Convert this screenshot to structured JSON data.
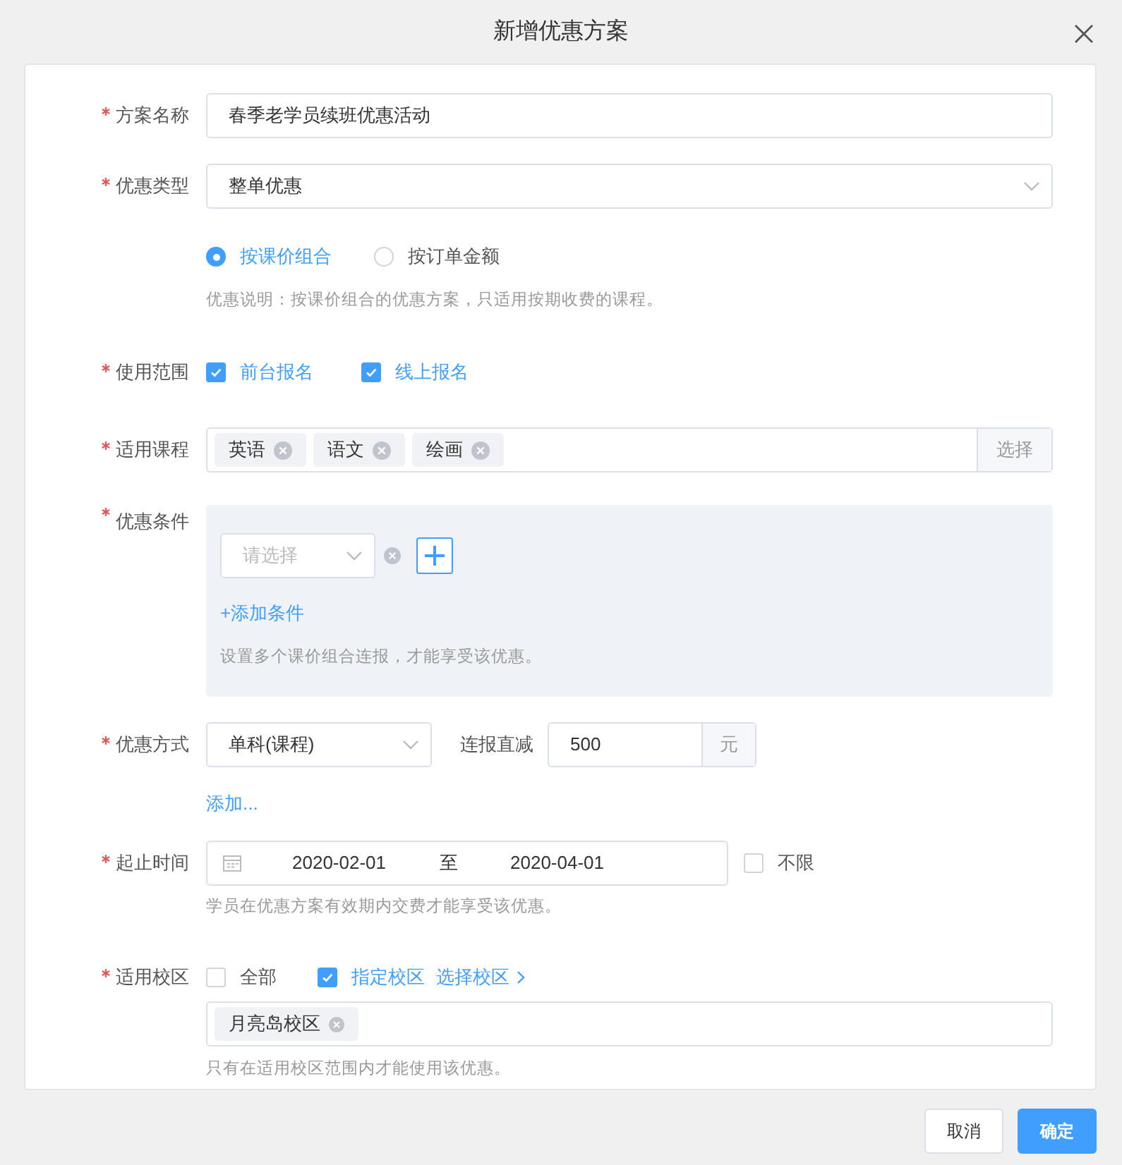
{
  "dialog": {
    "title": "新增优惠方案"
  },
  "plan_name": {
    "label": "方案名称",
    "required": true,
    "value": "春季老学员续班优惠活动"
  },
  "discount_type": {
    "label": "优惠类型",
    "required": true,
    "value": "整单优惠",
    "options": [
      {
        "label": "按课价组合",
        "selected": true
      },
      {
        "label": "按订单金额",
        "selected": false
      }
    ],
    "note": "优惠说明：按课价组合的优惠方案，只适用按期收费的课程。"
  },
  "scope": {
    "label": "使用范围",
    "required": true,
    "options": [
      {
        "label": "前台报名",
        "checked": true
      },
      {
        "label": "线上报名",
        "checked": true
      }
    ]
  },
  "courses": {
    "label": "适用课程",
    "required": true,
    "tags": [
      "英语",
      "语文",
      "绘画"
    ],
    "button": "选择"
  },
  "conditions": {
    "label": "优惠条件",
    "required": true,
    "select_placeholder": "请选择",
    "add_link": "+添加条件",
    "note": "设置多个课价组合连报，才能享受该优惠。"
  },
  "method": {
    "label": "优惠方式",
    "required": true,
    "value": "单科(课程)",
    "sub_label": "连报直减",
    "amount": "500",
    "unit": "元",
    "add_link": "添加..."
  },
  "period": {
    "label": "起止时间",
    "required": true,
    "start": "2020-02-01",
    "separator": "至",
    "end": "2020-04-01",
    "unlimited": {
      "label": "不限",
      "checked": false
    },
    "note": "学员在优惠方案有效期内交费才能享受该优惠。"
  },
  "campus": {
    "label": "适用校区",
    "required": true,
    "options": [
      {
        "label": "全部",
        "checked": false
      },
      {
        "label": "指定校区",
        "checked": true
      }
    ],
    "link": "选择校区",
    "tags": [
      "月亮岛校区"
    ],
    "note": "只有在适用校区范围内才能使用该优惠。"
  },
  "buttons": {
    "cancel": "取消",
    "confirm": "确定"
  }
}
